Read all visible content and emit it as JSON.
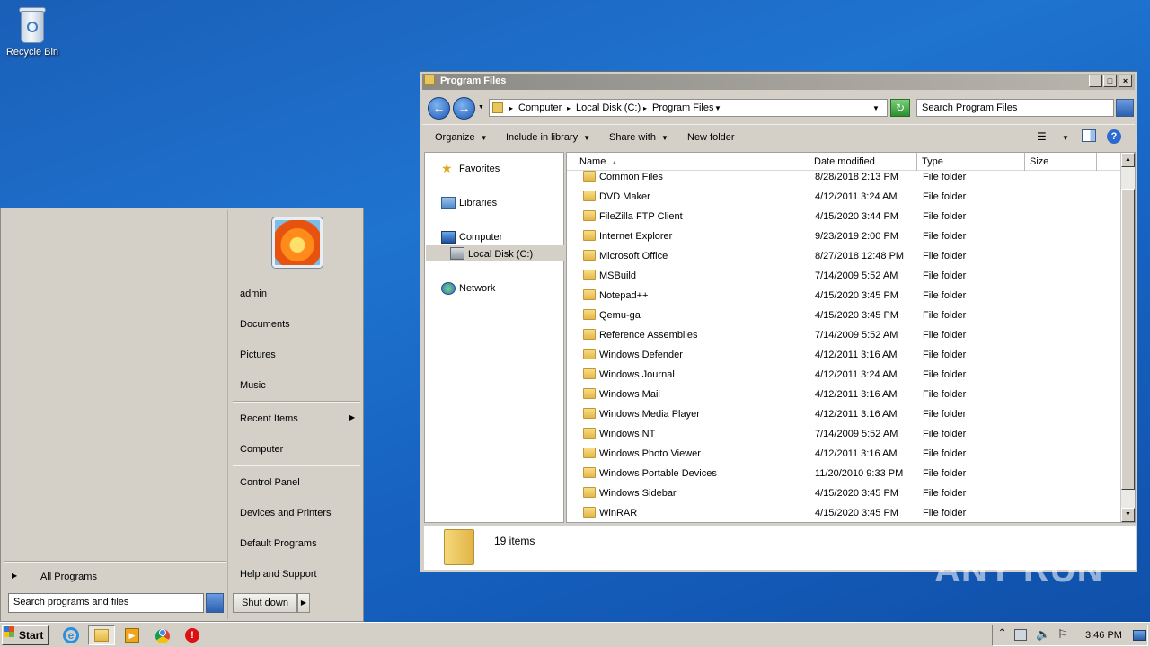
{
  "desktop": {
    "icons": [
      {
        "label": "Recycle Bin",
        "icon": "recycle-bin-icon"
      }
    ],
    "watermark": "ANY RUN"
  },
  "start_menu": {
    "user": "admin",
    "right_items": [
      "Documents",
      "Pictures",
      "Music",
      "Recent Items",
      "Computer",
      "Control Panel",
      "Devices and Printers",
      "Default Programs",
      "Help and Support"
    ],
    "all_programs": "All Programs",
    "search_placeholder": "Search programs and files",
    "shutdown": "Shut down"
  },
  "explorer": {
    "title": "Program Files",
    "breadcrumb": [
      "Computer",
      "Local Disk (C:)",
      "Program Files"
    ],
    "search_placeholder": "Search Program Files",
    "commands": [
      "Organize",
      "Include in library",
      "Share with",
      "New folder"
    ],
    "nav": {
      "favorites": "Favorites",
      "libraries": "Libraries",
      "computer": "Computer",
      "local_disk": "Local Disk (C:)",
      "network": "Network"
    },
    "columns": [
      "Name",
      "Date modified",
      "Type",
      "Size"
    ],
    "rows": [
      {
        "name": "Common Files",
        "date": "8/28/2018 2:13 PM",
        "type": "File folder"
      },
      {
        "name": "DVD Maker",
        "date": "4/12/2011 3:24 AM",
        "type": "File folder"
      },
      {
        "name": "FileZilla FTP Client",
        "date": "4/15/2020 3:44 PM",
        "type": "File folder"
      },
      {
        "name": "Internet Explorer",
        "date": "9/23/2019 2:00 PM",
        "type": "File folder"
      },
      {
        "name": "Microsoft Office",
        "date": "8/27/2018 12:48 PM",
        "type": "File folder"
      },
      {
        "name": "MSBuild",
        "date": "7/14/2009 5:52 AM",
        "type": "File folder"
      },
      {
        "name": "Notepad++",
        "date": "4/15/2020 3:45 PM",
        "type": "File folder"
      },
      {
        "name": "Qemu-ga",
        "date": "4/15/2020 3:45 PM",
        "type": "File folder"
      },
      {
        "name": "Reference Assemblies",
        "date": "7/14/2009 5:52 AM",
        "type": "File folder"
      },
      {
        "name": "Windows Defender",
        "date": "4/12/2011 3:16 AM",
        "type": "File folder"
      },
      {
        "name": "Windows Journal",
        "date": "4/12/2011 3:24 AM",
        "type": "File folder"
      },
      {
        "name": "Windows Mail",
        "date": "4/12/2011 3:16 AM",
        "type": "File folder"
      },
      {
        "name": "Windows Media Player",
        "date": "4/12/2011 3:16 AM",
        "type": "File folder"
      },
      {
        "name": "Windows NT",
        "date": "7/14/2009 5:52 AM",
        "type": "File folder"
      },
      {
        "name": "Windows Photo Viewer",
        "date": "4/12/2011 3:16 AM",
        "type": "File folder"
      },
      {
        "name": "Windows Portable Devices",
        "date": "11/20/2010 9:33 PM",
        "type": "File folder"
      },
      {
        "name": "Windows Sidebar",
        "date": "4/15/2020 3:45 PM",
        "type": "File folder"
      },
      {
        "name": "WinRAR",
        "date": "4/15/2020 3:45 PM",
        "type": "File folder"
      }
    ],
    "status": "19 items"
  },
  "taskbar": {
    "start": "Start",
    "pinned": [
      "internet-explorer-icon",
      "windows-explorer-icon",
      "media-player-icon",
      "chrome-icon",
      "stop-icon"
    ],
    "clock": "3:46 PM"
  }
}
